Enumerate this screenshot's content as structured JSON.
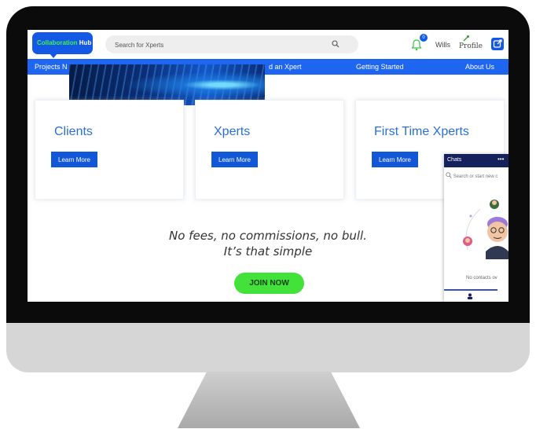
{
  "header": {
    "logo_main": "Collaboration ",
    "logo_accent": "Hub",
    "search_placeholder": "Search for Xperts",
    "notification_count": "0",
    "user_name": "Wills",
    "profile_label": "Profile"
  },
  "nav": [
    {
      "label": "Projects N"
    },
    {
      "label": "d an Xpert"
    },
    {
      "label": "Getting Started"
    },
    {
      "label": "About Us"
    }
  ],
  "cards": [
    {
      "title": "Clients",
      "button": "Learn More"
    },
    {
      "title": "Xperts",
      "button": "Learn More"
    },
    {
      "title": "First Time Xperts",
      "button": "Learn More"
    }
  ],
  "tagline": {
    "line1": "No fees, no commissions, no bull.",
    "line2": "It’s that simple"
  },
  "join_button": "JOIN NOW",
  "chat": {
    "title": "Chats",
    "more": "•••",
    "search_placeholder": "Search or start new c",
    "empty_text": "No contacts ov"
  },
  "colors": {
    "brand_blue": "#1459e6",
    "nav_blue": "#1e66f0",
    "join_green": "#42e23a",
    "logo_green": "#40f24c",
    "chat_header": "#14215c"
  }
}
